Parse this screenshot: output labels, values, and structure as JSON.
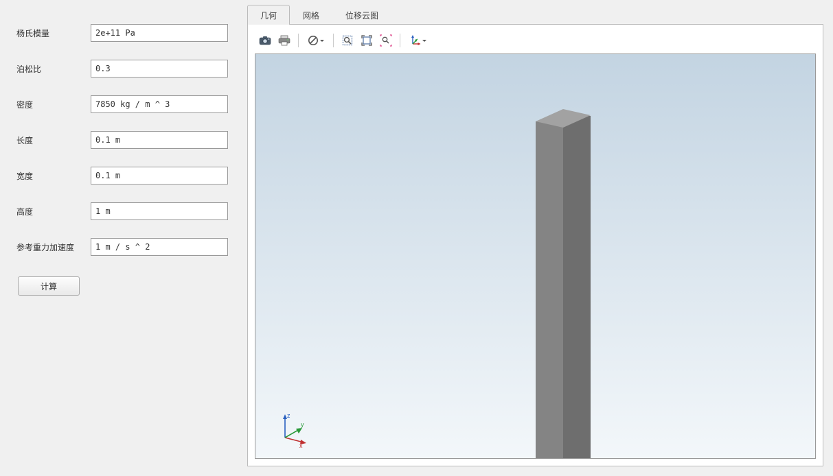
{
  "form": {
    "youngs_modulus": {
      "label": "杨氏模量",
      "value": "2e+11 Pa"
    },
    "poisson_ratio": {
      "label": "泊松比",
      "value": "0.3"
    },
    "density": {
      "label": "密度",
      "value": "7850 kg / m ^ 3"
    },
    "length": {
      "label": "长度",
      "value": "0.1 m"
    },
    "width": {
      "label": "宽度",
      "value": "0.1 m"
    },
    "height": {
      "label": "高度",
      "value": "1 m"
    },
    "gravity": {
      "label": "参考重力加速度",
      "value": "1 m / s ^ 2"
    },
    "compute_button": "计算"
  },
  "tabs": {
    "geometry": "几何",
    "mesh": "网格",
    "displacement": "位移云图"
  },
  "axes": {
    "x": "x",
    "y": "y",
    "z": "z"
  }
}
